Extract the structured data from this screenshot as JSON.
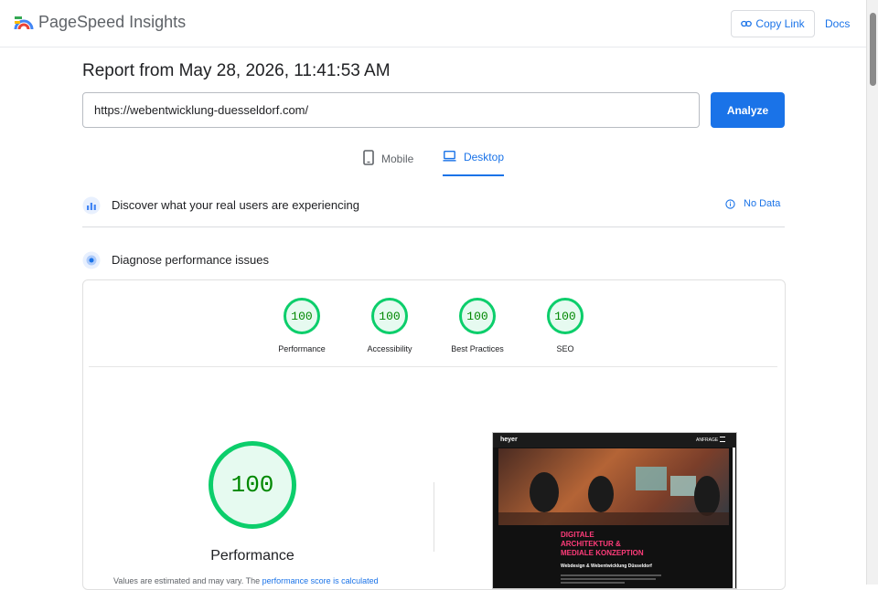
{
  "app": {
    "title": "PageSpeed Insights",
    "logo_icon": "pagespeed-logo-icon"
  },
  "header": {
    "copy_link_label": "Copy Link",
    "docs_label": "Docs"
  },
  "report": {
    "title": "Report from May 28, 2026, 11:41:53 AM"
  },
  "search": {
    "url_value": "https://webentwicklung-duesseldorf.com/",
    "analyze_label": "Analyze"
  },
  "tabs": [
    {
      "label": "Mobile",
      "icon": "mobile-icon",
      "selected": false
    },
    {
      "label": "Desktop",
      "icon": "desktop-icon",
      "selected": true
    }
  ],
  "sections": {
    "discover": {
      "label": "Discover what your real users are experiencing",
      "status": "No Data",
      "status_icon": "info-icon"
    },
    "diagnose": {
      "label": "Diagnose performance issues"
    }
  },
  "scores": [
    {
      "value": "100",
      "label": "Performance"
    },
    {
      "value": "100",
      "label": "Accessibility"
    },
    {
      "value": "100",
      "label": "Best Practices"
    },
    {
      "value": "100",
      "label": "SEO"
    }
  ],
  "performance": {
    "score": "100",
    "label": "Performance",
    "note_text": "Values are estimated and may vary. The ",
    "note_link": "performance score is calculated"
  },
  "screenshot": {
    "logo_text": "heyer",
    "nav_link": "ANFRAGE",
    "headline_lines": [
      "DIGITALE",
      "ARCHITEKTUR &",
      "MEDIALE KONZEPTION"
    ],
    "subheadline": "Webdesign & Webentwicklung Düsseldorf"
  },
  "colors": {
    "accent": "#1a73e8",
    "pass": "#0cce6b",
    "pass_text": "#008800",
    "headline": "#ff3c7a"
  }
}
